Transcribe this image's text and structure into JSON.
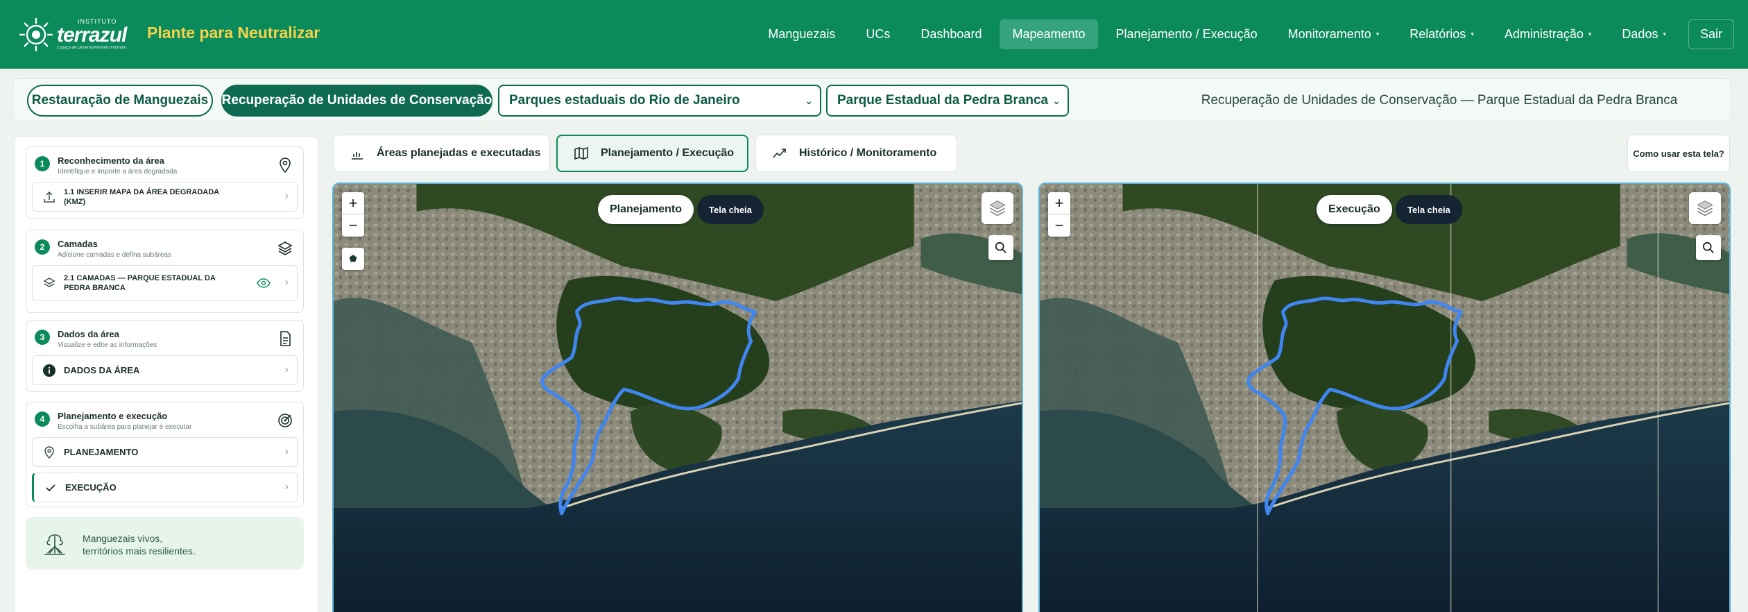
{
  "header": {
    "logo_small": "INSTITUTO",
    "logo_name": "terrazul",
    "logo_tagline": "Espaço de Desenvolvimento Humano",
    "app_title": "Plante para Neutralizar",
    "nav": [
      {
        "label": "Manguezais"
      },
      {
        "label": "UCs"
      },
      {
        "label": "Dashboard"
      },
      {
        "label": "Mapeamento",
        "active": true
      },
      {
        "label": "Planejamento / Execução"
      },
      {
        "label": "Monitoramento",
        "caret": "▾"
      },
      {
        "label": "Relatórios",
        "caret": "▾"
      },
      {
        "label": "Administração",
        "caret": "▾"
      },
      {
        "label": "Dados",
        "caret": "▾"
      }
    ],
    "logout": "Sair"
  },
  "filters": {
    "mode_mangroves": "Restauração de Manguezais",
    "mode_ucs": "Recuperação de Unidades de Conservação",
    "group_select": "Parques estaduais do Rio de Janeiro",
    "unit_select": "Parque Estadual da Pedra Branca",
    "summary": "Recuperação de Unidades de Conservação — Parque Estadual da Pedra Branca"
  },
  "sidebar": {
    "steps": [
      {
        "num": "1",
        "title": "Reconhecimento da área",
        "subtitle": "Identifique e importe a área degradada",
        "item": "1.1 INSERIR MAPA DA ÁREA DEGRADADA (KMZ)"
      },
      {
        "num": "2",
        "title": "Camadas",
        "subtitle": "Adicione camadas e defina subáreas",
        "item": "2.1 CAMADAS — PARQUE ESTADUAL DA PEDRA BRANCA"
      },
      {
        "num": "3",
        "title": "Dados da área",
        "subtitle": "Visualize e edite as informações",
        "item": "DADOS DA ÁREA"
      },
      {
        "num": "4",
        "title": "Planejamento e execução",
        "subtitle": "Escolha a subárea para planejar e executar",
        "item_plan": "PLANEJAMENTO",
        "item_exec": "EXECUÇÃO"
      }
    ],
    "promo_line1": "Manguezais vivos,",
    "promo_line2": "territórios mais resilientes."
  },
  "tabs": {
    "areas": "Áreas planejadas e executadas",
    "planning": "Planejamento / Execução",
    "history": "Histórico / Monitoramento",
    "help": "Como usar esta tela?"
  },
  "maps": {
    "left_label": "Planejamento",
    "right_label": "Execução",
    "fullscreen": "Tela cheia",
    "zoom_in": "+",
    "zoom_out": "−"
  },
  "colors": {
    "header": "#0b8b5c",
    "accent": "#0e6b51",
    "title_yellow": "#f6d24a",
    "boundary": "#3f86f0"
  }
}
